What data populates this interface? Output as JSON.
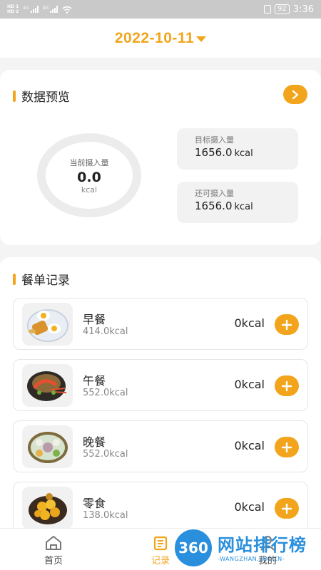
{
  "status_bar": {
    "sim1": "HD 1",
    "sim2": "HD 2",
    "net1": "4G",
    "net2": "4G",
    "battery": "92",
    "time": "3:36"
  },
  "header": {
    "date": "2022-10-11"
  },
  "overview": {
    "title": "数据预览",
    "ring": {
      "label": "当前摄入量",
      "value": "0.0",
      "unit": "kcal",
      "progress": 0
    },
    "target": {
      "label": "目标摄入量",
      "value": "1656.0",
      "unit": "kcal"
    },
    "remaining": {
      "label": "还可摄入量",
      "value": "1656.0",
      "unit": "kcal"
    }
  },
  "meals": {
    "title": "餐单记录",
    "items": [
      {
        "name": "早餐",
        "recommended": "414.0kcal",
        "intake": "0kcal",
        "image": "breakfast-dish-image"
      },
      {
        "name": "午餐",
        "recommended": "552.0kcal",
        "intake": "0kcal",
        "image": "lunch-dish-image"
      },
      {
        "name": "晚餐",
        "recommended": "552.0kcal",
        "intake": "0kcal",
        "image": "dinner-dish-image"
      },
      {
        "name": "零食",
        "recommended": "138.0kcal",
        "intake": "0kcal",
        "image": "snack-dish-image"
      }
    ]
  },
  "tabbar": {
    "tabs": [
      {
        "label": "首页",
        "icon": "home-icon",
        "active": false
      },
      {
        "label": "记录",
        "icon": "record-icon",
        "active": true
      },
      {
        "label": "我的",
        "icon": "profile-icon",
        "active": false
      }
    ]
  },
  "watermark": {
    "badge": "360",
    "text": "网站排行榜",
    "url": "-WANGZHAN.360.CN-"
  },
  "colors": {
    "accent": "#f2a51c",
    "watermark": "#2a8fdc"
  }
}
